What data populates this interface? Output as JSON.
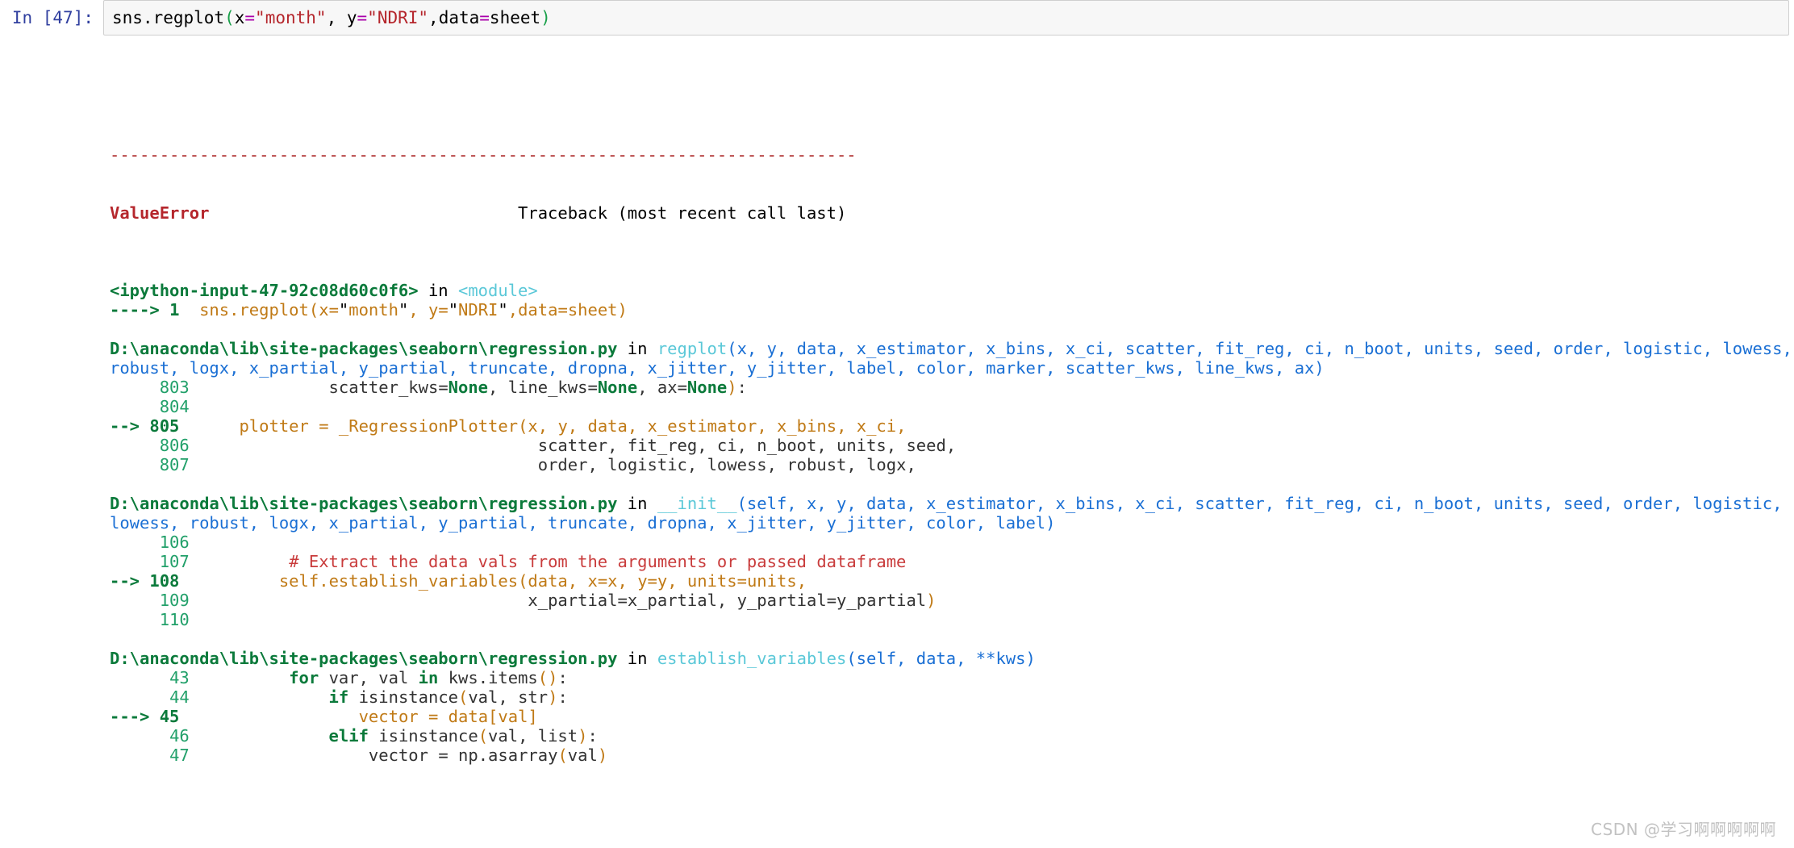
{
  "cell": {
    "prompt_label": "In  [47]:",
    "source": "sns.regplot(x=\"month\", y=\"NDRI\",data=sheet)",
    "source_parts": {
      "head": "sns.regplot",
      "open_paren": "(",
      "x_key": "x",
      "eq1": "=",
      "x_val": "\"month\"",
      "comma1": ", ",
      "y_key": "y",
      "eq2": "=",
      "y_val": "\"NDRI\"",
      "comma2": ",",
      "data_key": "data",
      "eq3": "=",
      "data_val": "sheet",
      "close_paren": ")"
    }
  },
  "traceback": {
    "separator": "---------------------------------------------------------------------------",
    "error_name": "ValueError",
    "error_header_right": "Traceback (most recent call last)",
    "frames": [
      {
        "location_prefix": "<ipython-input-47-92c08d60c0f6>",
        "in_word": " in ",
        "func_name": "<module>",
        "signature": "",
        "lines": [
          {
            "marker": "---->",
            "number": "1",
            "code": "sns.regplot(x=\"month\", y=\"NDRI\",data=sheet)",
            "highlight": true
          }
        ]
      },
      {
        "location_prefix": "D:\\anaconda\\lib\\site-packages\\seaborn\\regression.py",
        "in_word": " in ",
        "func_name": "regplot",
        "signature": "(x, y, data, x_estimator, x_bins, x_ci, scatter, fit_reg, ci, n_boot, units, seed, order, logistic, lowess, robust, logx, x_partial, y_partial, truncate, dropna, x_jitter, y_jitter, label, color, marker, scatter_kws, line_kws, ax)",
        "lines": [
          {
            "marker": "",
            "number": "803",
            "code": "            scatter_kws=None, line_kws=None, ax=None):",
            "highlight": false
          },
          {
            "marker": "",
            "number": "804",
            "code": "",
            "highlight": false
          },
          {
            "marker": "-->",
            "number": "805",
            "code": "    plotter = _RegressionPlotter(x, y, data, x_estimator, x_bins, x_ci,",
            "highlight": true
          },
          {
            "marker": "",
            "number": "806",
            "code": "                                 scatter, fit_reg, ci, n_boot, units, seed,",
            "highlight": false
          },
          {
            "marker": "",
            "number": "807",
            "code": "                                 order, logistic, lowess, robust, logx,",
            "highlight": false
          }
        ]
      },
      {
        "location_prefix": "D:\\anaconda\\lib\\site-packages\\seaborn\\regression.py",
        "in_word": " in ",
        "func_name": "__init__",
        "signature": "(self, x, y, data, x_estimator, x_bins, x_ci, scatter, fit_reg, ci, n_boot, units, seed, order, logistic, lowess, robust, logx, x_partial, y_partial, truncate, dropna, x_jitter, y_jitter, color, label)",
        "lines": [
          {
            "marker": "",
            "number": "106",
            "code": "",
            "highlight": false
          },
          {
            "marker": "",
            "number": "107",
            "code": "        # Extract the data vals from the arguments or passed dataframe",
            "highlight": false,
            "comment": true
          },
          {
            "marker": "-->",
            "number": "108",
            "code": "        self.establish_variables(data, x=x, y=y, units=units,",
            "highlight": true
          },
          {
            "marker": "",
            "number": "109",
            "code": "                                x_partial=x_partial, y_partial=y_partial)",
            "highlight": false
          },
          {
            "marker": "",
            "number": "110",
            "code": "",
            "highlight": false
          }
        ]
      },
      {
        "location_prefix": "D:\\anaconda\\lib\\site-packages\\seaborn\\regression.py",
        "in_word": " in ",
        "func_name": "establish_variables",
        "signature": "(self, data, **kws)",
        "lines": [
          {
            "marker": "",
            "number": "43",
            "code": "        for var, val in kws.items():",
            "highlight": false
          },
          {
            "marker": "",
            "number": "44",
            "code": "            if isinstance(val, str):",
            "highlight": false
          },
          {
            "marker": "--->",
            "number": "45",
            "code": "                vector = data[val]",
            "highlight": true
          },
          {
            "marker": "",
            "number": "46",
            "code": "            elif isinstance(val, list):",
            "highlight": false
          },
          {
            "marker": "",
            "number": "47",
            "code": "                vector = np.asarray(val)",
            "highlight": false
          }
        ]
      }
    ]
  },
  "watermark": {
    "text": "CSDN @学习啊啊啊啊啊"
  },
  "colors": {
    "error_red": "#b5262c",
    "path_green": "#0b7a3b",
    "func_cyan": "#5bc8d8",
    "param_blue": "#1a6fd4",
    "lineno_green": "#22a06a",
    "highlight_amber": "#c07a16",
    "comment_red": "#c93c3c",
    "prompt_indigo": "#303f9f",
    "cell_bg": "#f7f7f7",
    "watermark_gray": "#c2c2c2"
  }
}
